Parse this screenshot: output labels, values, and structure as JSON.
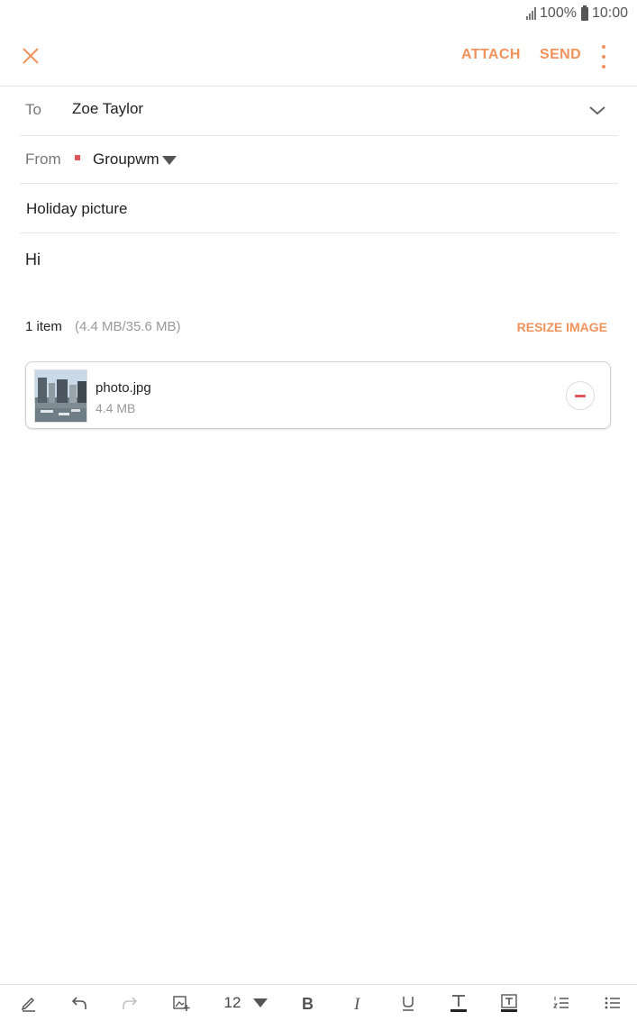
{
  "status": {
    "battery": "100%",
    "time": "10:00"
  },
  "header": {
    "attach_label": "ATTACH",
    "send_label": "SEND"
  },
  "to": {
    "label": "To",
    "value": "Zoe Taylor"
  },
  "from": {
    "label": "From",
    "value": "Groupwm"
  },
  "subject": "Holiday picture",
  "body": "Hi",
  "attachments": {
    "count": "1 item",
    "size_summary": "(4.4 MB/35.6 MB)",
    "resize_label": "RESIZE IMAGE",
    "items": [
      {
        "name": "photo.jpg",
        "size": "4.4 MB"
      }
    ]
  },
  "toolbar": {
    "font_size": "12"
  },
  "colors": {
    "accent": "#f0925c",
    "remove": "#e0565b",
    "account_dot": "#e0565b"
  },
  "icons": [
    "close-icon",
    "more-icon",
    "chevron-down-icon",
    "pen-icon",
    "undo-icon",
    "redo-icon",
    "insert-image-icon",
    "bold-icon",
    "italic-icon",
    "underline-icon",
    "text-color-icon",
    "text-background-icon",
    "numbered-list-icon",
    "bulleted-list-icon",
    "remove-icon"
  ]
}
